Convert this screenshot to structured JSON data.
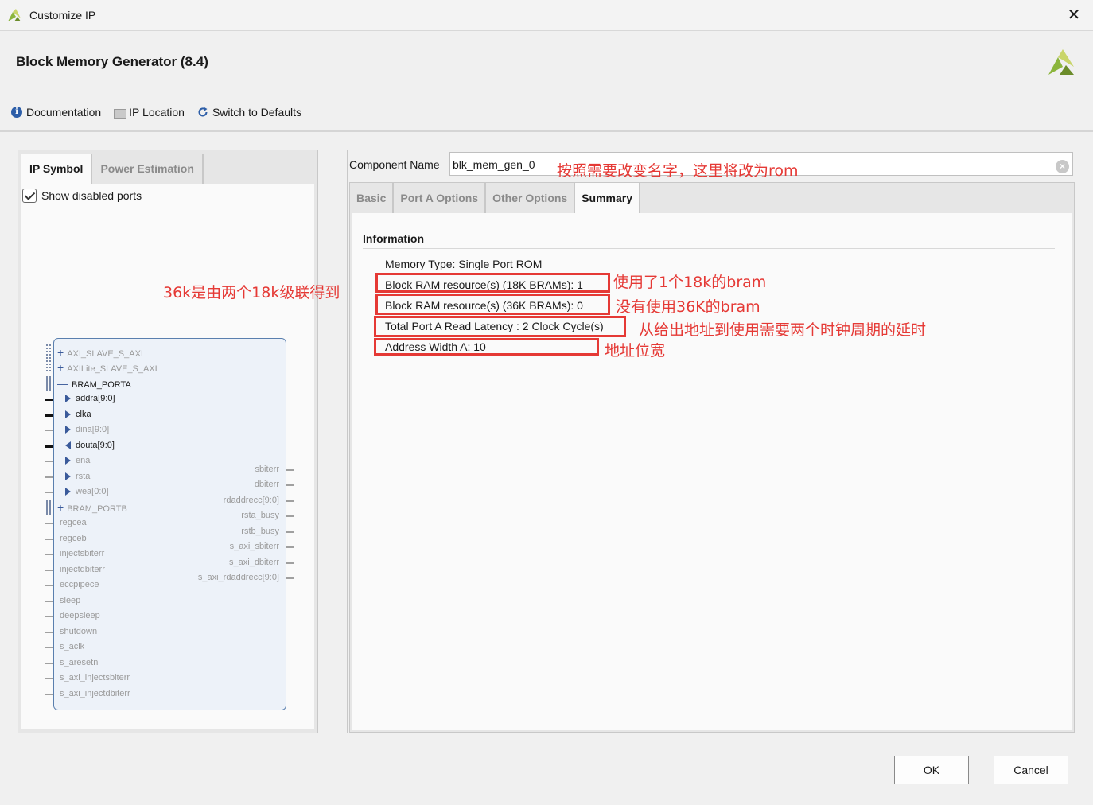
{
  "window": {
    "title": "Customize IP",
    "close_glyph": "✕"
  },
  "header": {
    "title": "Block Memory Generator (8.4)"
  },
  "toolbar": {
    "documentation": "Documentation",
    "ip_location": "IP Location",
    "switch_defaults": "Switch to Defaults",
    "doc_icon_glyph": "i"
  },
  "left": {
    "tabs": [
      "IP Symbol",
      "Power Estimation"
    ],
    "show_disabled_ports": "Show disabled ports",
    "symbol": {
      "left_ports": [
        "AXI_SLAVE_S_AXI",
        "AXILite_SLAVE_S_AXI",
        "BRAM_PORTA",
        "addra[9:0]",
        "clka",
        "dina[9:0]",
        "douta[9:0]",
        "ena",
        "rsta",
        "wea[0:0]",
        "BRAM_PORTB",
        "regcea",
        "regceb",
        "injectsbiterr",
        "injectdbiterr",
        "eccpipece",
        "sleep",
        "deepsleep",
        "shutdown",
        "s_aclk",
        "s_aresetn",
        "s_axi_injectsbiterr",
        "s_axi_injectdbiterr"
      ],
      "right_ports": [
        "sbiterr",
        "dbiterr",
        "rdaddrecc[9:0]",
        "rsta_busy",
        "rstb_busy",
        "s_axi_sbiterr",
        "s_axi_dbiterr",
        "s_axi_rdaddrecc[9:0]"
      ]
    }
  },
  "right": {
    "component_name_label": "Component Name",
    "component_name_value": "blk_mem_gen_0",
    "clear_glyph": "×",
    "tabs": [
      "Basic",
      "Port A Options",
      "Other Options",
      "Summary"
    ],
    "info_title": "Information",
    "info_items": [
      "Memory Type: Single Port ROM",
      "Block RAM resource(s) (18K BRAMs): 1",
      "Block RAM resource(s) (36K BRAMs): 0",
      "Total Port A Read Latency : 2 Clock Cycle(s)",
      "Address Width A: 10"
    ]
  },
  "annotations": {
    "rename": "按照需要改变名字，这里将改为rom",
    "cascade": "36k是由两个18k级联得到",
    "bram18": "使用了1个18k的bram",
    "bram36": "没有使用36K的bram",
    "latency": "从给出地址到使用需要两个时钟周期的延时",
    "addr_width": "地址位宽"
  },
  "buttons": {
    "ok": "OK",
    "cancel": "Cancel"
  },
  "colors": {
    "annotation": "#e53935",
    "accent": "#2d5ea8",
    "brand_green": "#8bb53c"
  }
}
